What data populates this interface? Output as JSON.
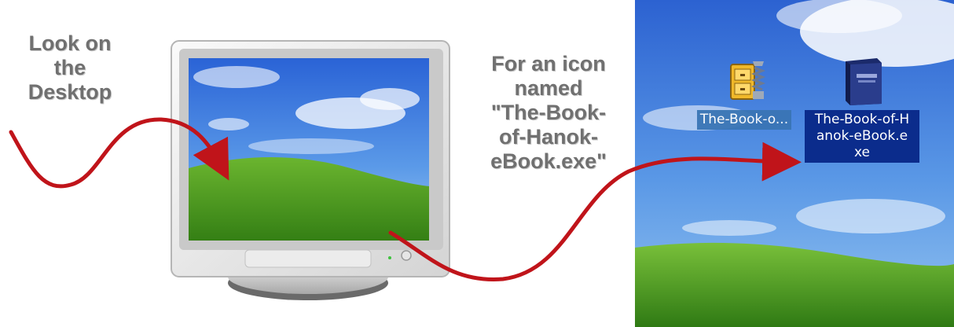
{
  "captions": {
    "look_lines": [
      "Look on",
      "the",
      "Desktop"
    ],
    "for_lines": [
      "For an icon",
      "named",
      "\"The-Book-",
      "of-Hanok-",
      "eBook.exe\""
    ]
  },
  "desktop": {
    "icons": [
      {
        "label": "The-Book-o...",
        "icon": "archive-icon",
        "selected": false
      },
      {
        "label_lines": [
          "The-Book-of-H",
          "anok-eBook.e",
          "xe"
        ],
        "icon": "book-icon",
        "selected": true
      }
    ]
  },
  "colors": {
    "arrow": "#c0141a",
    "caption": "#707070",
    "selection": "#0b2c8c"
  }
}
